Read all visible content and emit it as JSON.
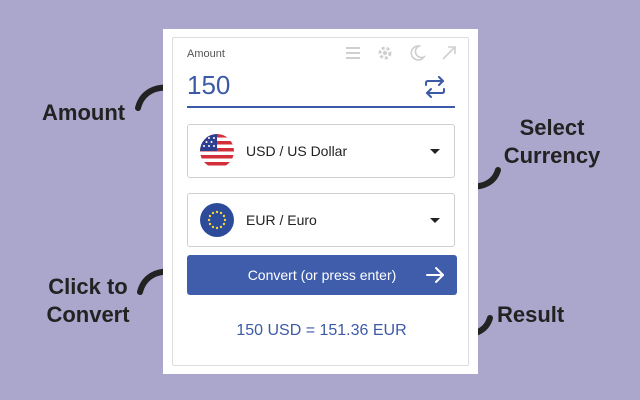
{
  "annotations": {
    "amount": "Amount",
    "select_currency_line1": "Select",
    "select_currency_line2": "Currency",
    "click_line1": "Click to",
    "click_line2": "Convert",
    "result": "Result"
  },
  "widget": {
    "amount_label": "Amount",
    "amount_value": "150",
    "toolbar_icons": [
      "menu-icon",
      "gear-icon",
      "moon-icon",
      "expand-icon"
    ],
    "from_currency": {
      "label": "USD / US Dollar",
      "flag": "us-flag-icon"
    },
    "to_currency": {
      "label": "EUR / Euro",
      "flag": "eu-flag-icon"
    },
    "convert_label": "Convert (or press enter)",
    "result_text": "150 USD = 151.36 EUR"
  },
  "colors": {
    "background": "#aba6cc",
    "accent": "#3c5aa8",
    "button": "#3f5dab"
  }
}
